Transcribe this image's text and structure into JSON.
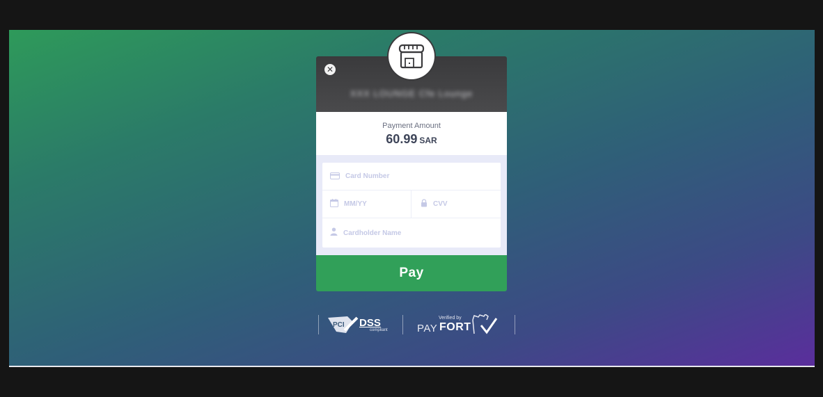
{
  "merchant": {
    "name": "XXX LOUNGE Cfe Lounge",
    "logo_icon": "store-icon"
  },
  "payment": {
    "label": "Payment Amount",
    "amount": "60.99",
    "currency": "SAR"
  },
  "form": {
    "card_number_placeholder": "Card Number",
    "expiry_placeholder": "MM/YY",
    "cvv_placeholder": "CVV",
    "cardholder_placeholder": "Cardholder Name"
  },
  "pay_button": {
    "label": "Pay"
  },
  "badges": {
    "pci_logo_text": "PCI",
    "dss_text": "DSS",
    "compliant_text": "compliant",
    "payfort_pay": "PAY",
    "payfort_fort": "FORT",
    "payfort_verified": "Verified by"
  },
  "colors": {
    "pay_green": "#31a059",
    "header_dark": "#3a3a3c",
    "placeholder": "#c5c9e6",
    "form_background": "#e8eaf8"
  }
}
